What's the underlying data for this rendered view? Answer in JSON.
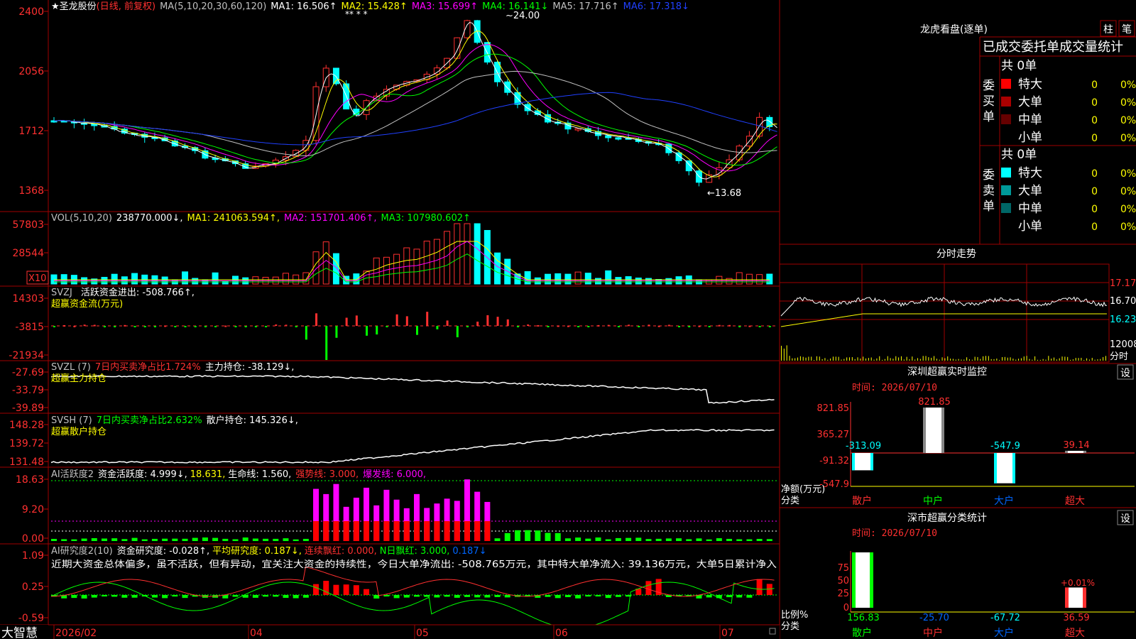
{
  "stock": {
    "star": "★",
    "name": "圣龙股份",
    "mode": "(日线, 前复权)"
  },
  "price_panel": {
    "ma_label": "MA(5,10,20,30,60,120)",
    "ma": [
      {
        "label": "MA1: 16.506↑",
        "color": "#ffffff"
      },
      {
        "label": "MA2: 15.428↑",
        "color": "#ffff00"
      },
      {
        "label": "MA3: 15.699↑",
        "color": "#ff00ff"
      },
      {
        "label": "MA4: 16.141↓",
        "color": "#00ff00"
      },
      {
        "label": "MA5: 17.716↑",
        "color": "#c0c0c0"
      },
      {
        "label": "MA6: 17.318↓",
        "color": "#0000ff"
      }
    ],
    "y_ticks": [
      "2400",
      "2056",
      "1712",
      "1368"
    ],
    "high_label": "24.00",
    "low_label": "13.68",
    "markers": "** * *"
  },
  "vol_panel": {
    "title": "VOL(5,10,20)",
    "value": "238770.000↓,",
    "ma": [
      {
        "label": "MA1: 241063.594↑,",
        "color": "#ffff00"
      },
      {
        "label": "MA2: 151701.406↑,",
        "color": "#ff00ff"
      },
      {
        "label": "MA3: 107980.602↑",
        "color": "#00ff00"
      }
    ],
    "y_ticks": [
      "57803",
      "28544"
    ],
    "unit": "X10"
  },
  "svzj_panel": {
    "title": "SVZJ",
    "line1": "活跃资金进出: -508.766↑,",
    "line2": "超赢资金流(万元)",
    "y_ticks": [
      "14303",
      "-3815",
      "-21934"
    ]
  },
  "svzl_panel": {
    "title": "SVZL (7)",
    "red_text": "7日内买卖净占比1.724%",
    "white_text": "主力持仓: -38.129↓,",
    "line2": "超赢主力持仓",
    "y_ticks": [
      "-27.69",
      "-33.79",
      "-39.89"
    ]
  },
  "svsh_panel": {
    "title": "SVSH (7)",
    "green_text": "7日内买卖净占比2.632%",
    "white_text": "散户持仓: 145.326↓,",
    "line2": "超赢散户持仓",
    "y_ticks": [
      "148.28",
      "139.72",
      "131.48"
    ]
  },
  "ai1_panel": {
    "title": "AI活跃度2",
    "t1": "资金活跃度: 4.999↓,",
    "t2": "18.631,",
    "t3": "生命线: 1.560,",
    "t4": "强势线: 3.000,",
    "t5": "爆发线: 6.000,",
    "y_ticks": [
      "18.63",
      "9.20",
      "0.00"
    ]
  },
  "ai2_panel": {
    "title": "AI研究度2(10)",
    "t1": "资金研究度: -0.028↑,",
    "t2": "平均研究度: 0.187↓,",
    "t3": "连续飘红: 0.000,",
    "t4": "N日飘红: 3.000,",
    "t5": "0.187↓",
    "comment": "近期大资金总体偏多，虽不活跃，但有异动，宜关注大资金的持续性，今日大单净流出: -508.765万元，其中特大单净流入: 39.136万元，大单5日累计净入",
    "y_ticks": [
      "1.09",
      "0.25",
      "-0.59"
    ]
  },
  "bottom": {
    "brand": "大智慧",
    "dates": [
      "2026/02",
      "04",
      "05",
      "06",
      "07"
    ]
  },
  "dragon": {
    "title": "龙虎看盘(逐单)",
    "btn1": "柱",
    "btn2": "笔",
    "subtitle": "已成交委托单成交量统计",
    "buy": {
      "side": "委买单",
      "total": "共 0单",
      "rows": [
        {
          "label": "特大",
          "count": "0",
          "pct": "0%",
          "color": "#ff0000"
        },
        {
          "label": "大单",
          "count": "0",
          "pct": "0%",
          "color": "#aa0000"
        },
        {
          "label": "中单",
          "count": "0",
          "pct": "0%",
          "color": "#660000"
        },
        {
          "label": "小单",
          "count": "0",
          "pct": "0%",
          "color": ""
        }
      ]
    },
    "sell": {
      "side": "委卖单",
      "total": "共 0单",
      "rows": [
        {
          "label": "特大",
          "count": "0",
          "pct": "0%",
          "color": "#00ffff"
        },
        {
          "label": "大单",
          "count": "0",
          "pct": "0%",
          "color": "#009999"
        },
        {
          "label": "中单",
          "count": "0",
          "pct": "0%",
          "color": "#006666"
        },
        {
          "label": "小单",
          "count": "0",
          "pct": "0%",
          "color": ""
        }
      ]
    }
  },
  "intraday": {
    "title": "分时走势",
    "ticks": [
      "17.17",
      "16.70",
      "16.23"
    ],
    "vol_tick": "12008",
    "vol_unit": "分时"
  },
  "monitor": {
    "title": "深圳超赢实时监控",
    "btn": "设",
    "time": "时间: 2026/07/10",
    "y_ticks": [
      "821.85",
      "365.27",
      "-91.32",
      "-547.9"
    ],
    "unit1": "净额(万元)",
    "unit2": "分类",
    "categories": [
      "散户",
      "中户",
      "大户",
      "超大"
    ],
    "values": [
      -313.09,
      821.85,
      -547.9,
      39.14
    ],
    "labels": [
      "-313.09",
      "821.85",
      "-547.9",
      "39.14"
    ]
  },
  "stats": {
    "title": "深市超赢分类统计",
    "btn": "设",
    "time": "时间: 2026/07/10",
    "y_ticks": [
      "75",
      "50",
      "25",
      "0"
    ],
    "unit1": "比例%",
    "unit2": "分类",
    "categories": [
      "散户",
      "中户",
      "大户",
      "超大"
    ],
    "values": [
      156.83,
      -25.7,
      -67.72,
      36.59
    ],
    "labels": [
      "156.83",
      "-25.70",
      "-67.72",
      "36.59"
    ],
    "extra": "+0.01%"
  }
}
